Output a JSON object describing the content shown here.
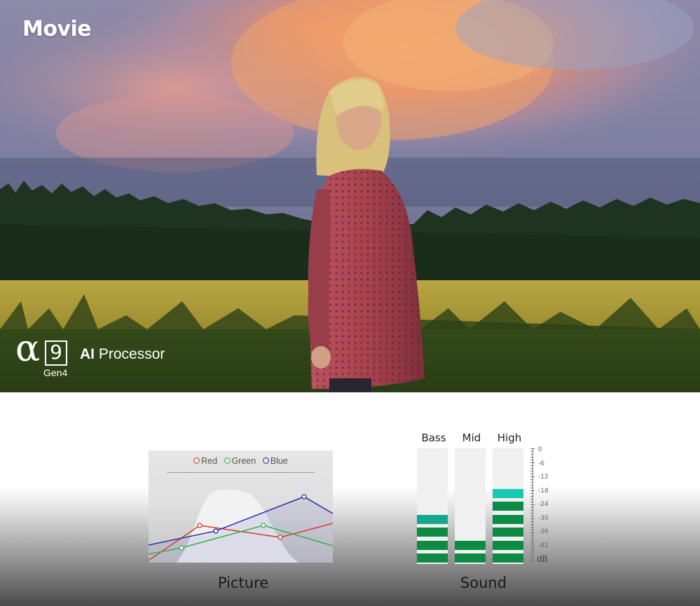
{
  "hero": {
    "mode_label": "Movie"
  },
  "badge": {
    "alpha": "α",
    "number": "9",
    "gen": "Gen4",
    "ai": "AI",
    "processor": "Processor"
  },
  "picture": {
    "caption": "Picture",
    "legend": [
      {
        "label": "Red",
        "color": "#d23c2a"
      },
      {
        "label": "Green",
        "color": "#2bb24c"
      },
      {
        "label": "Blue",
        "color": "#2a2aa8"
      }
    ]
  },
  "sound": {
    "caption": "Sound",
    "scale_unit": "dB",
    "scale_labels": [
      "0",
      "-6",
      "-12",
      "-18",
      "-24",
      "-30",
      "-36",
      "-42"
    ],
    "channels": [
      {
        "label": "Bass",
        "level_db": -30,
        "lit_segments": 4,
        "color": "#0d8a44",
        "top_color": "#13a98e"
      },
      {
        "label": "Mid",
        "level_db": -42,
        "lit_segments": 2,
        "color": "#0d8a44",
        "top_color": "#0d8a44"
      },
      {
        "label": "High",
        "level_db": -18,
        "lit_segments": 6,
        "color": "#0d8a44",
        "top_color": "#17c9b0"
      }
    ]
  }
}
